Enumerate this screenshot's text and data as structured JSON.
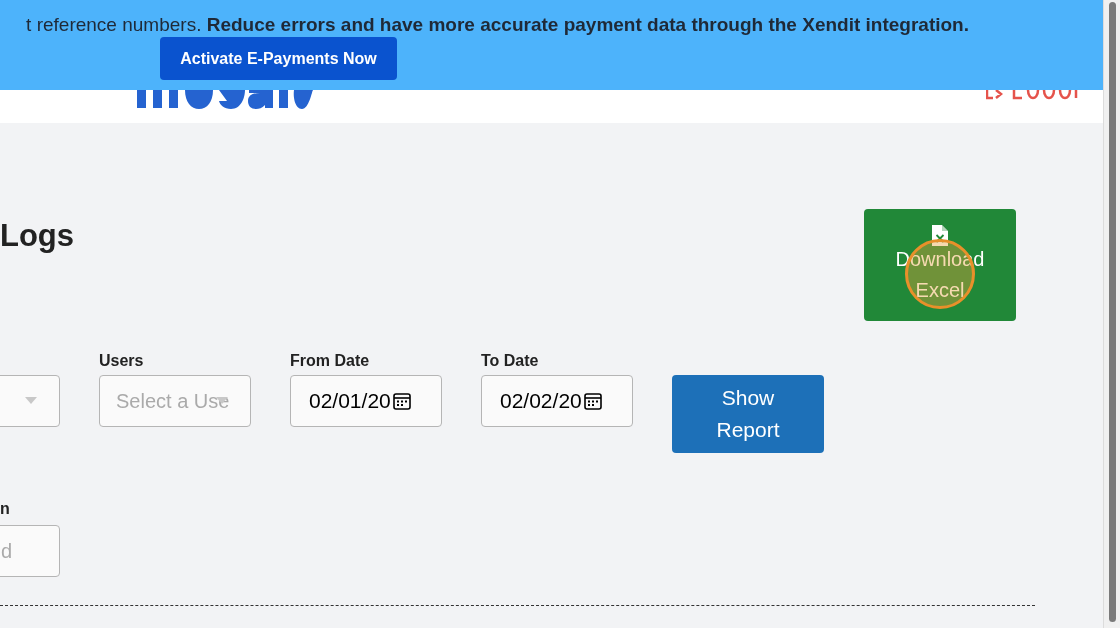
{
  "banner": {
    "text": "t reference numbers. **Reduce errors and have more accurate payment data through the Xendit integration.**",
    "button": "Activate E-Payments Now"
  },
  "page": {
    "title": "Logs",
    "download_button": "Download Excel"
  },
  "filters": [
    {
      "kind": "select"
    },
    {
      "kind": "select",
      "label": "Users",
      "placeholder": "Select a Use"
    },
    {
      "kind": "date",
      "label": "From Date",
      "value": "02/01/20"
    },
    {
      "kind": "date",
      "label": "To Date",
      "value": "02/02/20"
    }
  ],
  "show_report_button": "Show Report",
  "second_row": [
    {
      "kind": "text",
      "label": "n",
      "placeholder": "d"
    }
  ]
}
